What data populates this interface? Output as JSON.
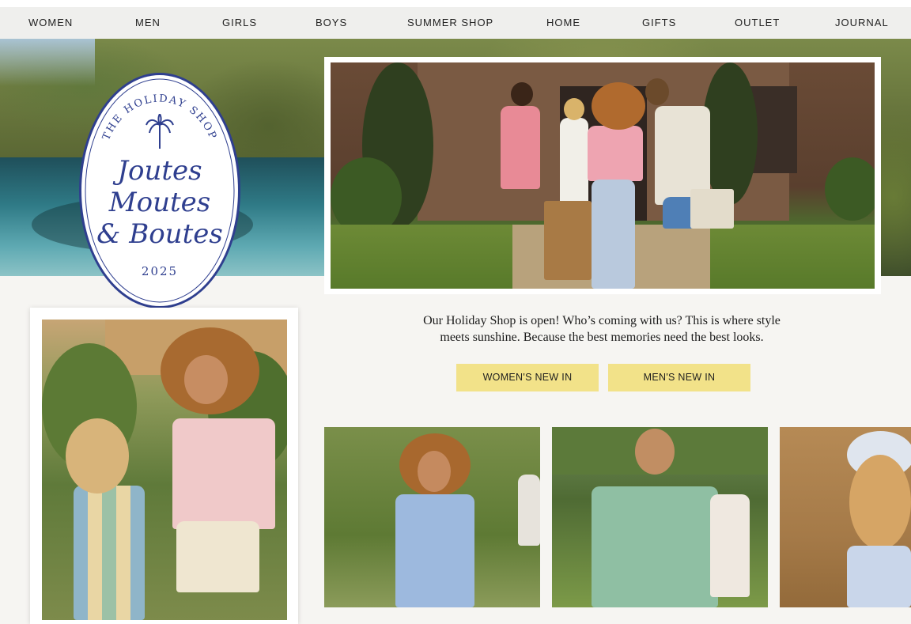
{
  "nav": {
    "items": [
      "WOMEN",
      "MEN",
      "GIRLS",
      "BOYS",
      "SUMMER SHOP",
      "HOME",
      "GIFTS",
      "OUTLET",
      "JOURNAL"
    ]
  },
  "badge": {
    "arc_text": "THE HOLIDAY SHOP",
    "line1": "Joutes",
    "line2": "Moutes",
    "line3": "& Boutes",
    "year": "2025",
    "color": "#2f3f8f",
    "icon": "palm-tree-icon"
  },
  "intro": {
    "line1": "Our Holiday Shop is open! Who’s coming with us? This is where style",
    "line2": "meets sunshine. Because the best memories need the best looks."
  },
  "cta": {
    "womens": "WOMEN'S NEW IN",
    "mens": "MEN'S NEW IN",
    "color": "#f2e289"
  },
  "images": {
    "hero": "photo-group-of-friends-with-luggage",
    "left_card": "photo-two-women-in-summer-outfits",
    "tile1": "photo-woman-in-blue-dress",
    "tile2": "photo-man-in-green-linen-shirt",
    "tile3": "photo-woman-with-headband"
  }
}
